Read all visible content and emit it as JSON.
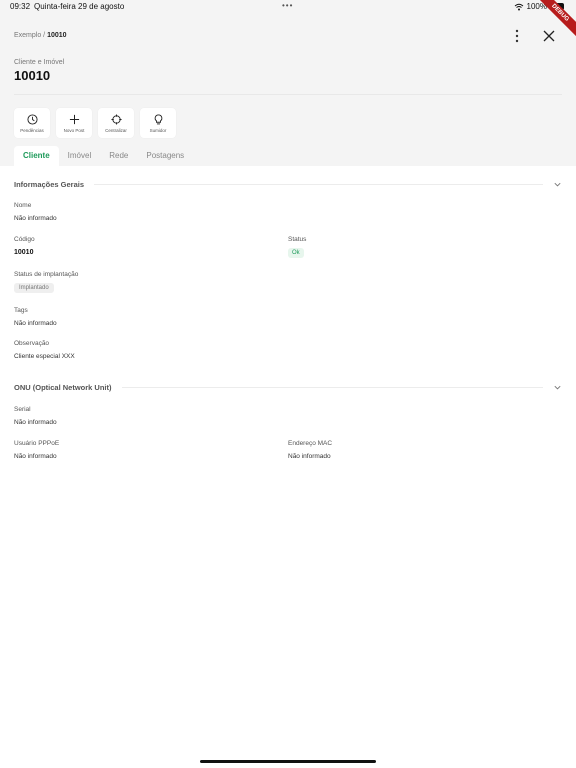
{
  "status_bar": {
    "time": "09:32",
    "date": "Quinta-feira 29 de agosto",
    "dots": "•••",
    "battery": "100%"
  },
  "debug_banner": "DEBUG",
  "breadcrumb": {
    "parent": "Exemplo",
    "separator": " / ",
    "current": "10010"
  },
  "header": {
    "subtitle": "Cliente e Imóvel",
    "title": "10010"
  },
  "actions": [
    {
      "label": "Pendências",
      "icon": "clock-icon"
    },
    {
      "label": "Novo Post",
      "icon": "plus-icon"
    },
    {
      "label": "Centralizar",
      "icon": "crosshair-icon"
    },
    {
      "label": "Sumidor",
      "icon": "lightbulb-icon"
    }
  ],
  "tabs": [
    {
      "label": "Cliente",
      "active": true
    },
    {
      "label": "Imóvel",
      "active": false
    },
    {
      "label": "Rede",
      "active": false
    },
    {
      "label": "Postagens",
      "active": false
    }
  ],
  "sections": {
    "general": {
      "title": "Informações Gerais",
      "nome_label": "Nome",
      "nome_value": "Não informado",
      "codigo_label": "Código",
      "codigo_value": "10010",
      "status_label": "Status",
      "status_value": "Ok",
      "implantacao_label": "Status de implantação",
      "implantacao_value": "Implantado",
      "tags_label": "Tags",
      "tags_value": "Não informado",
      "obs_label": "Observação",
      "obs_value": "Cliente especial XXX"
    },
    "onu": {
      "title": "ONU (Optical Network Unit)",
      "serial_label": "Serial",
      "serial_value": "Não informado",
      "pppoe_label": "Usuário PPPoE",
      "pppoe_value": "Não informado",
      "mac_label": "Endereço MAC",
      "mac_value": "Não informado"
    }
  },
  "colors": {
    "accent": "#1e9a5a",
    "header_bg": "#f4f4f4",
    "ok_badge_bg": "#e7f6ed"
  }
}
